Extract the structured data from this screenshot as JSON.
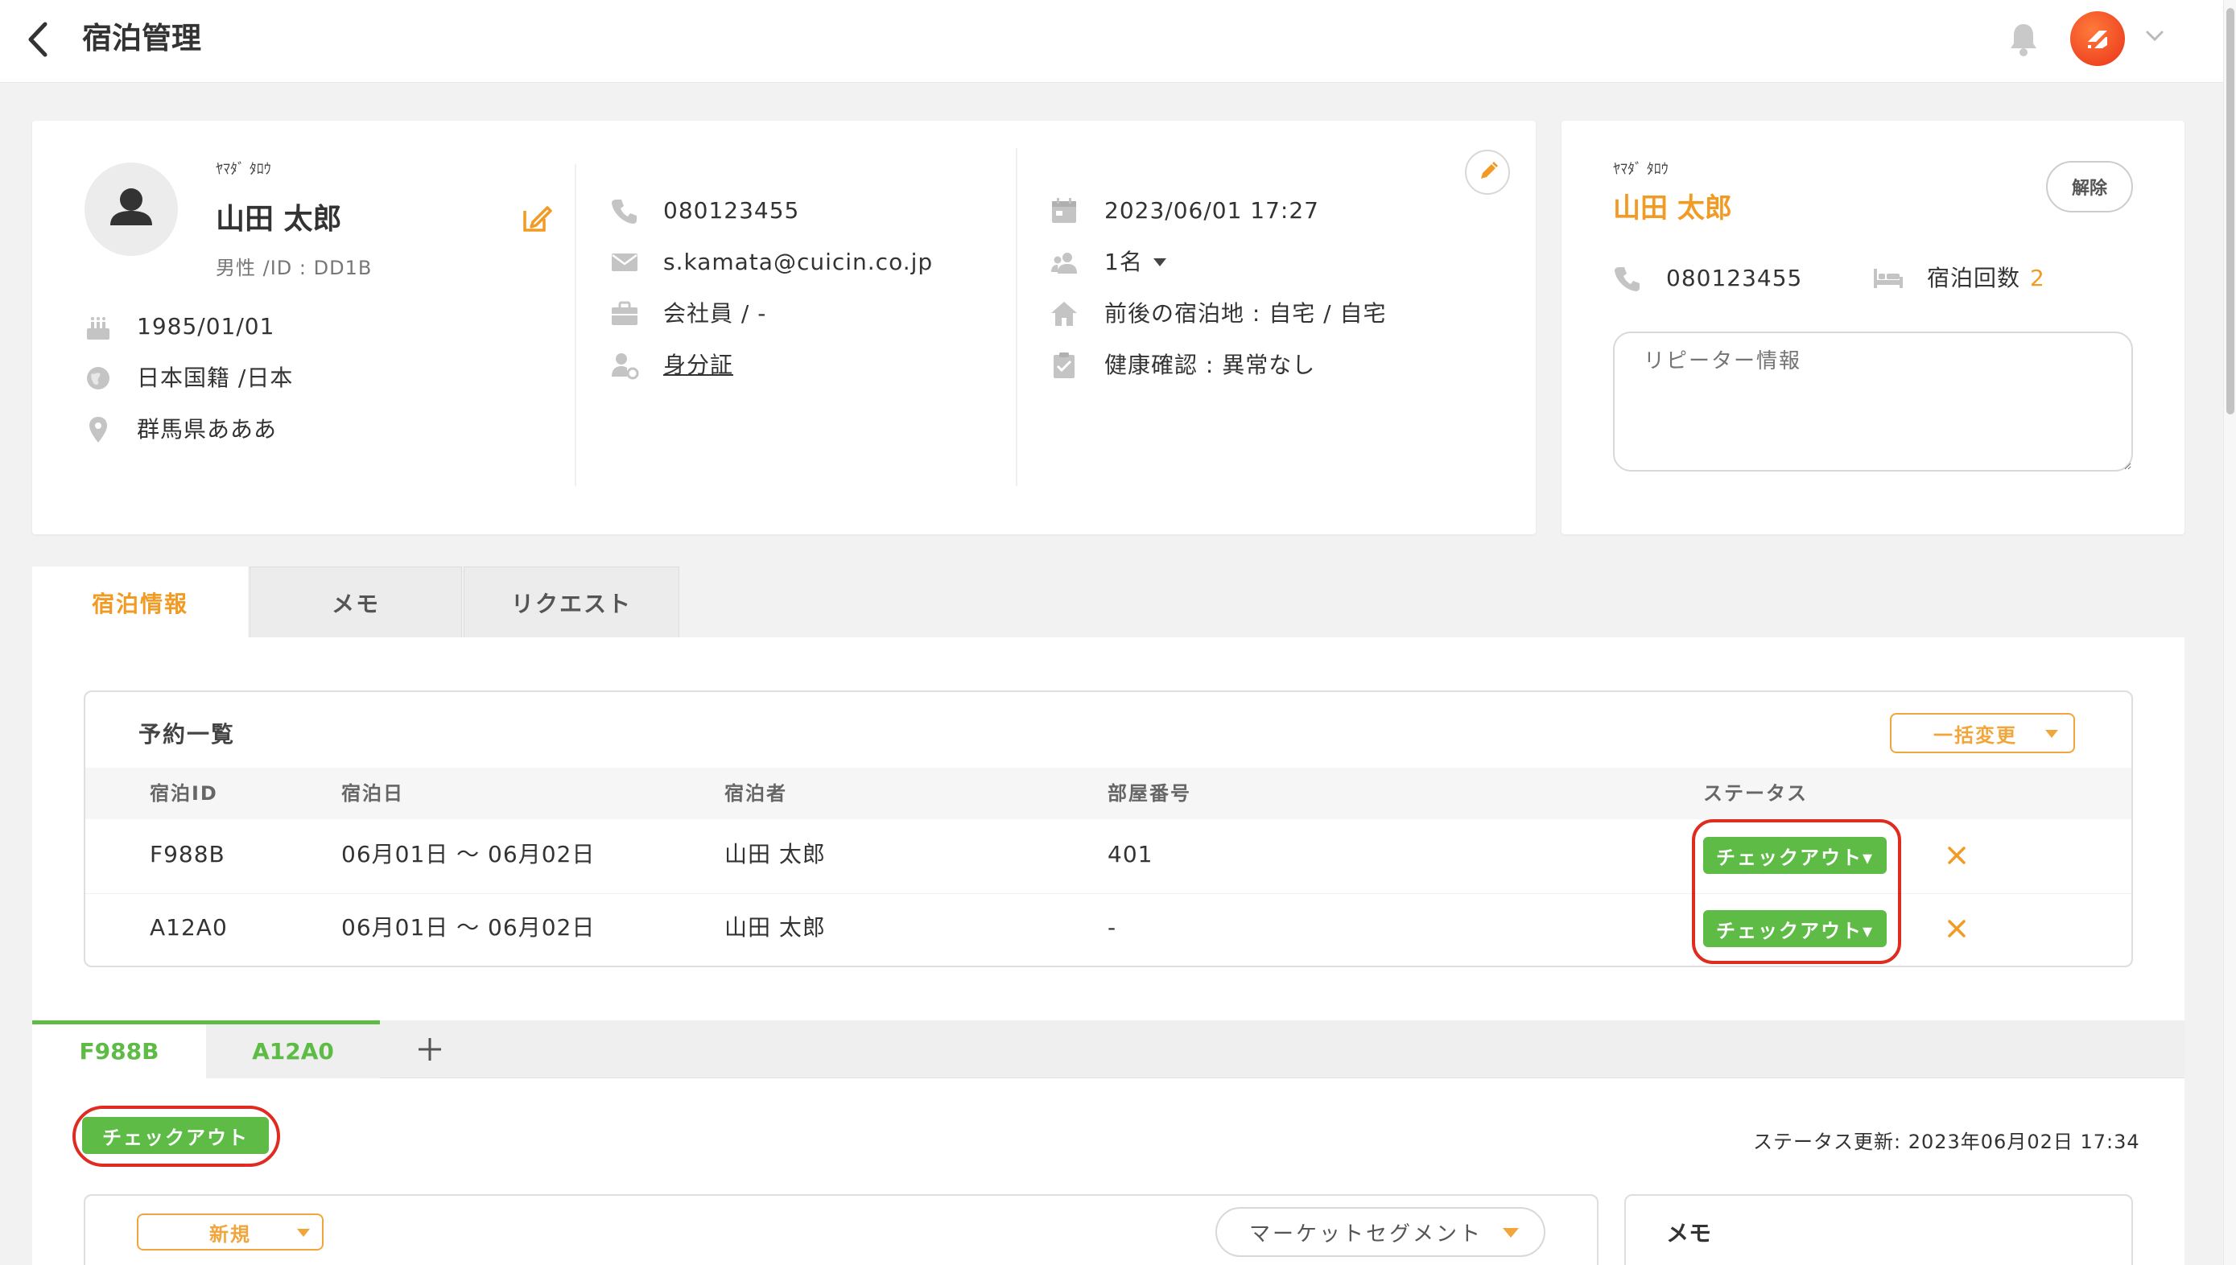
{
  "header": {
    "title": "宿泊管理"
  },
  "profile": {
    "name_kana": "ﾔﾏﾀﾞ ﾀﾛｳ",
    "name": "山田 太郎",
    "gender_id": "男性 /ID : DD1B",
    "birthday": "1985/01/01",
    "nationality": "日本国籍 /日本",
    "address": "群馬県あああ",
    "phone": "080123455",
    "email": "s.kamata@cuicin.co.jp",
    "occupation": "会社員 / -",
    "id_document": "身分証",
    "datetime": "2023/06/01 17:27",
    "guests": "1名",
    "prev_next_stay": "前後の宿泊地 : 自宅 / 自宅",
    "health_check": "健康確認 : 異常なし"
  },
  "repeater": {
    "name_kana": "ﾔﾏﾀﾞ ﾀﾛｳ",
    "name": "山田 太郎",
    "release_label": "解除",
    "phone": "080123455",
    "stay_count_label": "宿泊回数",
    "stay_count": "2",
    "info_placeholder": "リピーター情報"
  },
  "tabs": [
    {
      "label": "宿泊情報",
      "active": true
    },
    {
      "label": "メモ",
      "active": false
    },
    {
      "label": "リクエスト",
      "active": false
    }
  ],
  "reservations": {
    "title": "予約一覧",
    "bulk_change_label": "一括変更",
    "columns": [
      "宿泊ID",
      "宿泊日",
      "宿泊者",
      "部屋番号",
      "ステータス"
    ],
    "rows": [
      {
        "id": "F988B",
        "dates": "06月01日 ～ 06月02日",
        "guest": "山田 太郎",
        "room": "401",
        "status": "チェックアウト▾"
      },
      {
        "id": "A12A0",
        "dates": "06月01日 ～ 06月02日",
        "guest": "山田 太郎",
        "room": "-",
        "status": "チェックアウト▾"
      }
    ]
  },
  "subtabs": [
    {
      "label": "F988B",
      "active": true
    },
    {
      "label": "A12A0",
      "active": false
    }
  ],
  "detail": {
    "status_button": "チェックアウト",
    "status_updated": "ステータス更新: 2023年06月02日 17:34",
    "type_select": "新規",
    "market_segment": "マーケットセグメント",
    "memo_title": "メモ"
  },
  "colors": {
    "accent_orange": "#f29b24",
    "status_green": "#5dbb46",
    "highlight_red": "#e02b20"
  }
}
